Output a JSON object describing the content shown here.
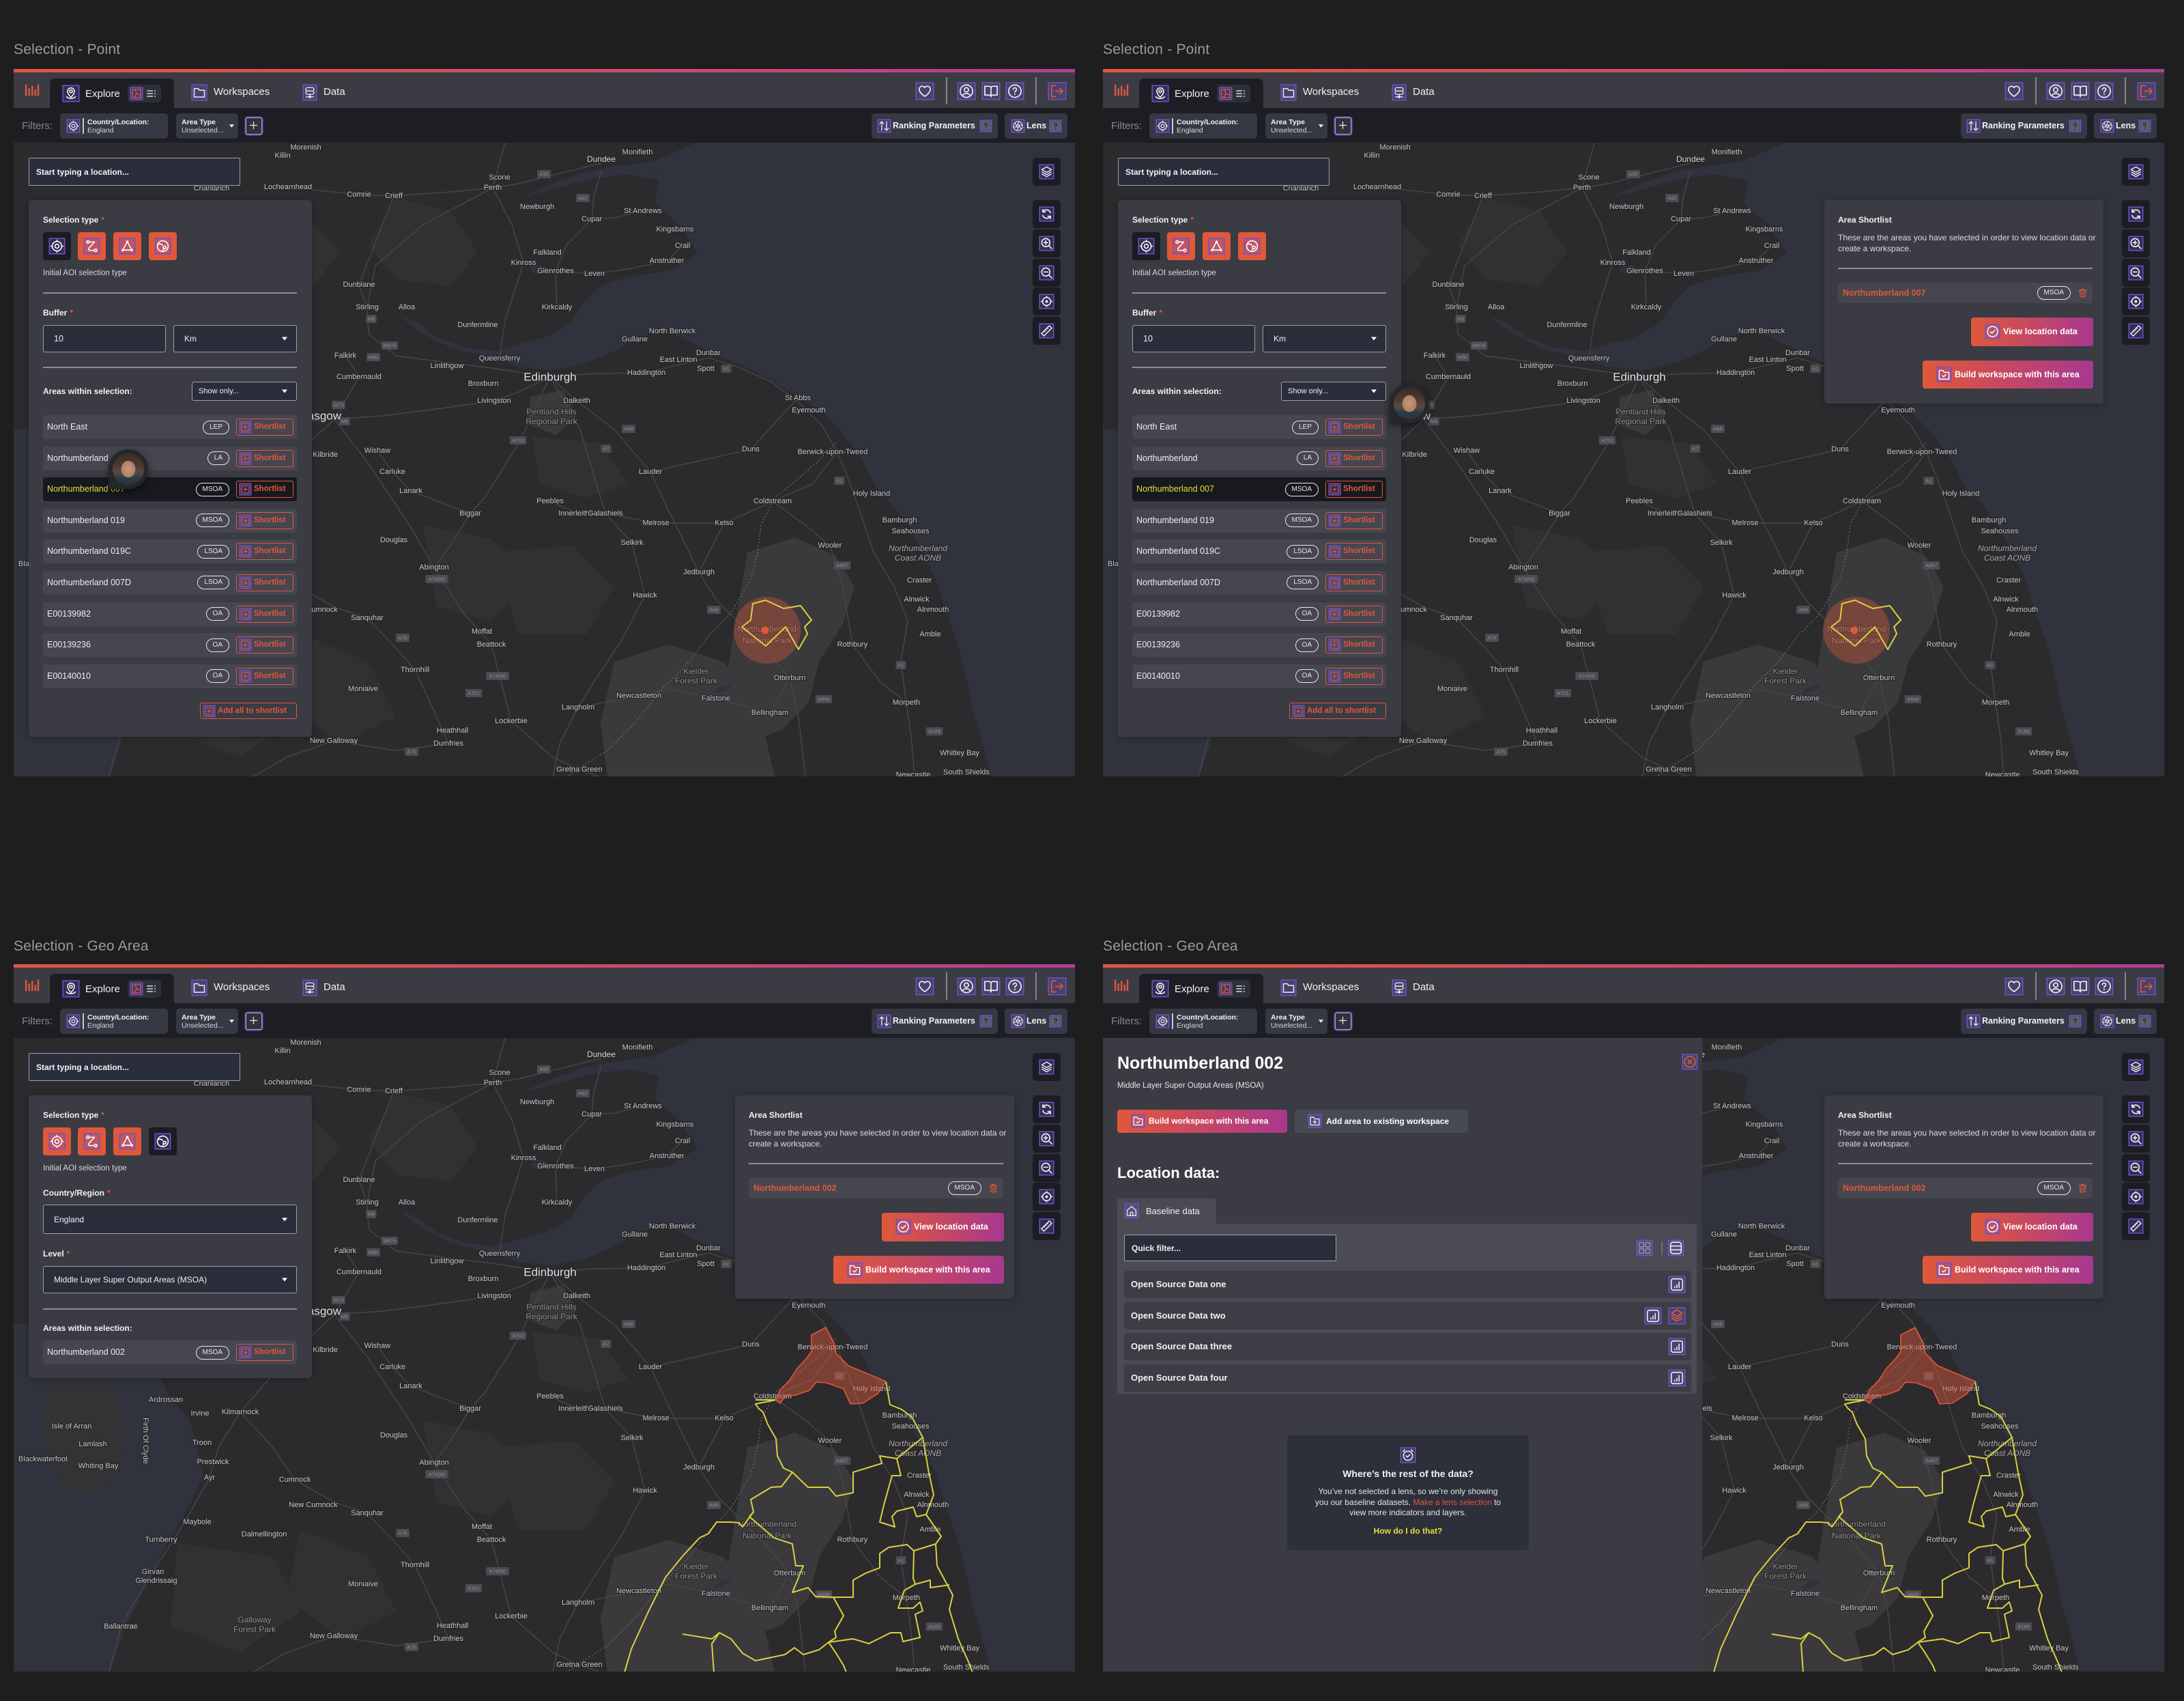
{
  "frames": [
    {
      "label": "Selection - Point"
    },
    {
      "label": "Selection - Point"
    },
    {
      "label": "Selection - Geo Area"
    },
    {
      "label": "Selection - Geo Area"
    }
  ],
  "colors": {
    "accent_orange": "#e0583a",
    "accent_magenta": "#a8388f",
    "highlight_yellow": "#e3df3c",
    "boundary_yellow": "#d9d13e",
    "selection_fill": "#e0583a"
  },
  "app": {
    "nav": {
      "explore": "Explore",
      "workspaces": "Workspaces",
      "data": "Data"
    },
    "filters": {
      "label": "Filters:",
      "country_title": "Country/Location:",
      "country_value": "England",
      "area_type_title": "Area Type",
      "area_type_value": "Unselected..."
    },
    "toolbar": {
      "ranking": "Ranking Parameters",
      "lens": "Lens"
    },
    "search": {
      "placeholder": "Start typing a location..."
    }
  },
  "point_panel": {
    "selection_type_label": "Selection type",
    "required_mark": "*",
    "active_selection_type": "point",
    "selection_hint": "Initial AOI selection type",
    "buffer_label": "Buffer",
    "buffer_value": "10",
    "buffer_unit": "Km",
    "areas_label": "Areas within selection:",
    "show_only": "Show only...",
    "shortlist_label": "Shortlist",
    "add_all": "Add all to shortlist",
    "areas": [
      {
        "name": "North East",
        "type": "LEP"
      },
      {
        "name": "Northumberland",
        "type": "LA"
      },
      {
        "name": "Northumberland 007",
        "type": "MSOA",
        "selected": true
      },
      {
        "name": "Northumberland 019",
        "type": "MSOA"
      },
      {
        "name": "Northumberland 019C",
        "type": "LSOA"
      },
      {
        "name": "Northumberland 007D",
        "type": "LSOA"
      },
      {
        "name": "E00139982",
        "type": "OA"
      },
      {
        "name": "E00139236",
        "type": "OA"
      },
      {
        "name": "E00140010",
        "type": "OA"
      }
    ]
  },
  "geo_panel": {
    "selection_type_label": "Selection type",
    "required_mark": "*",
    "active_selection_type": "geo-area",
    "selection_hint": "Initial AOI selection type",
    "country_label": "Country/Region",
    "country_value": "England",
    "level_label": "Level",
    "level_value": "Middle Layer Super Output Areas (MSOA)",
    "areas_label": "Areas within selection:",
    "shortlist_label": "Shortlist",
    "areas": [
      {
        "name": "Northumberland 002",
        "type": "MSOA"
      }
    ]
  },
  "shortlists": {
    "point": {
      "title": "Area Shortlist",
      "description": "These are the areas you have selected in order to view location data or create a workspace.",
      "item_name": "Northumberland 007",
      "item_type": "MSOA",
      "view_button": "View location data",
      "build_button": "Build workspace with this area"
    },
    "geo": {
      "title": "Area Shortlist",
      "description": "These are the areas you have selected in order to view location data or create a workspace.",
      "item_name": "Northumberland 002",
      "item_type": "MSOA",
      "view_button": "View location data",
      "build_button": "Build workspace with this area"
    }
  },
  "detail": {
    "title": "Northumberland 002",
    "subtitle": "Middle Layer Super Output Areas (MSOA)",
    "build_button": "Build workspace with this area",
    "add_button": "Add area to existing workspace",
    "section_title": "Location data:",
    "tab": "Baseline data",
    "filter_placeholder": "Quick filter...",
    "datasets": [
      {
        "name": "Open Source Data one",
        "actions": [
          "chart"
        ]
      },
      {
        "name": "Open Source Data two",
        "actions": [
          "chart",
          "layers"
        ]
      },
      {
        "name": "Open Source Data three",
        "actions": [
          "chart"
        ]
      },
      {
        "name": "Open Source Data four",
        "actions": [
          "chart"
        ]
      }
    ],
    "notice": {
      "title": "Where’s the rest of the data?",
      "body_start": "You’ve not selected a lens, so we’re only showing you our baseline datasets. ",
      "body_link": "Make a lens selection",
      "body_end": " to view more indicators and layers.",
      "help_link": "How do I do that?"
    }
  },
  "map": {
    "labels": [
      "Morenish",
      "Killin",
      "Monifieth",
      "Dundee",
      "Scone",
      "Perth",
      "Crianlarich",
      "Lochearnhead",
      "Comrie",
      "Crieff",
      "Newburgh",
      "St Andrews",
      "Cupar",
      "Kingsbarns",
      "Crail",
      "Falkland",
      "Anstruther",
      "Kinross",
      "Glenrothes",
      "Leven",
      "Dunblane",
      "Stirling",
      "Alloa",
      "Kirkcaldy",
      "Dunfermline",
      "North Berwick",
      "Gullane",
      "Dunbar",
      "Falkirk",
      "Queensferry",
      "East Linton",
      "Linlithgow",
      "Spott",
      "Haddington",
      "Cumbernauld",
      "Edinburgh",
      "Broxburn",
      "St Abbs",
      "Livingston",
      "Dalkeith",
      "Eyemouth",
      "Pentland Hills",
      "Regional Park",
      "Glasgow",
      "Duns",
      "Wishaw",
      "Berwick-upon-Tweed",
      "East Kilbride",
      "Carluke",
      "Lauder",
      "Lanark",
      "Holy Island",
      "Peebles",
      "Coldstream",
      "Ardrossan",
      "Biggar",
      "Innerleithen",
      "Galashiels",
      "Kilmarnock",
      "Irvine",
      "Bamburgh",
      "Melrose",
      "Kelso",
      "Isle of Arran",
      "Seahouses",
      "Douglas",
      "Selkirk",
      "Wooler",
      "Firth Of Clyde",
      "Troon",
      "Northumberland",
      "Lamlash",
      "Coast AONB",
      "Blackwaterfoot",
      "Prestwick",
      "Abington",
      "Whiting Bay",
      "Jedburgh",
      "Craster",
      "Ayr",
      "Cumnock",
      "Hawick",
      "Alnwick",
      "Alnmouth",
      "New Cumnock",
      "Sanquhar",
      "Maybole",
      "Northumberland",
      "Moffat",
      "Amble",
      "Dalmellington",
      "National Park",
      "Turnberry",
      "Beattock",
      "Rothbury",
      "Thornhill",
      "Kielder",
      "Girvan",
      "Otterburn",
      "Forest Park",
      "Glendrissaig",
      "Moniaive",
      "Newcastleton",
      "Falstone",
      "Morpeth",
      "Langholm",
      "Bellingham",
      "Lockerbie",
      "Galloway",
      "Heathhall",
      "Ballantrae",
      "Forest Park",
      "New Galloway",
      "Dumfries",
      "Whitley Bay",
      "Gretna Green",
      "South Shields",
      "Newcastle"
    ],
    "road_labels": [
      "A90",
      "A92",
      "M9",
      "M876",
      "M80",
      "A1",
      "M73",
      "M8",
      "A702",
      "A7",
      "A68",
      "A1",
      "A697",
      "A74(M)",
      "A68",
      "A76",
      "A1",
      "A74(M)",
      "A701",
      "A696",
      "A189",
      "A75"
    ]
  }
}
